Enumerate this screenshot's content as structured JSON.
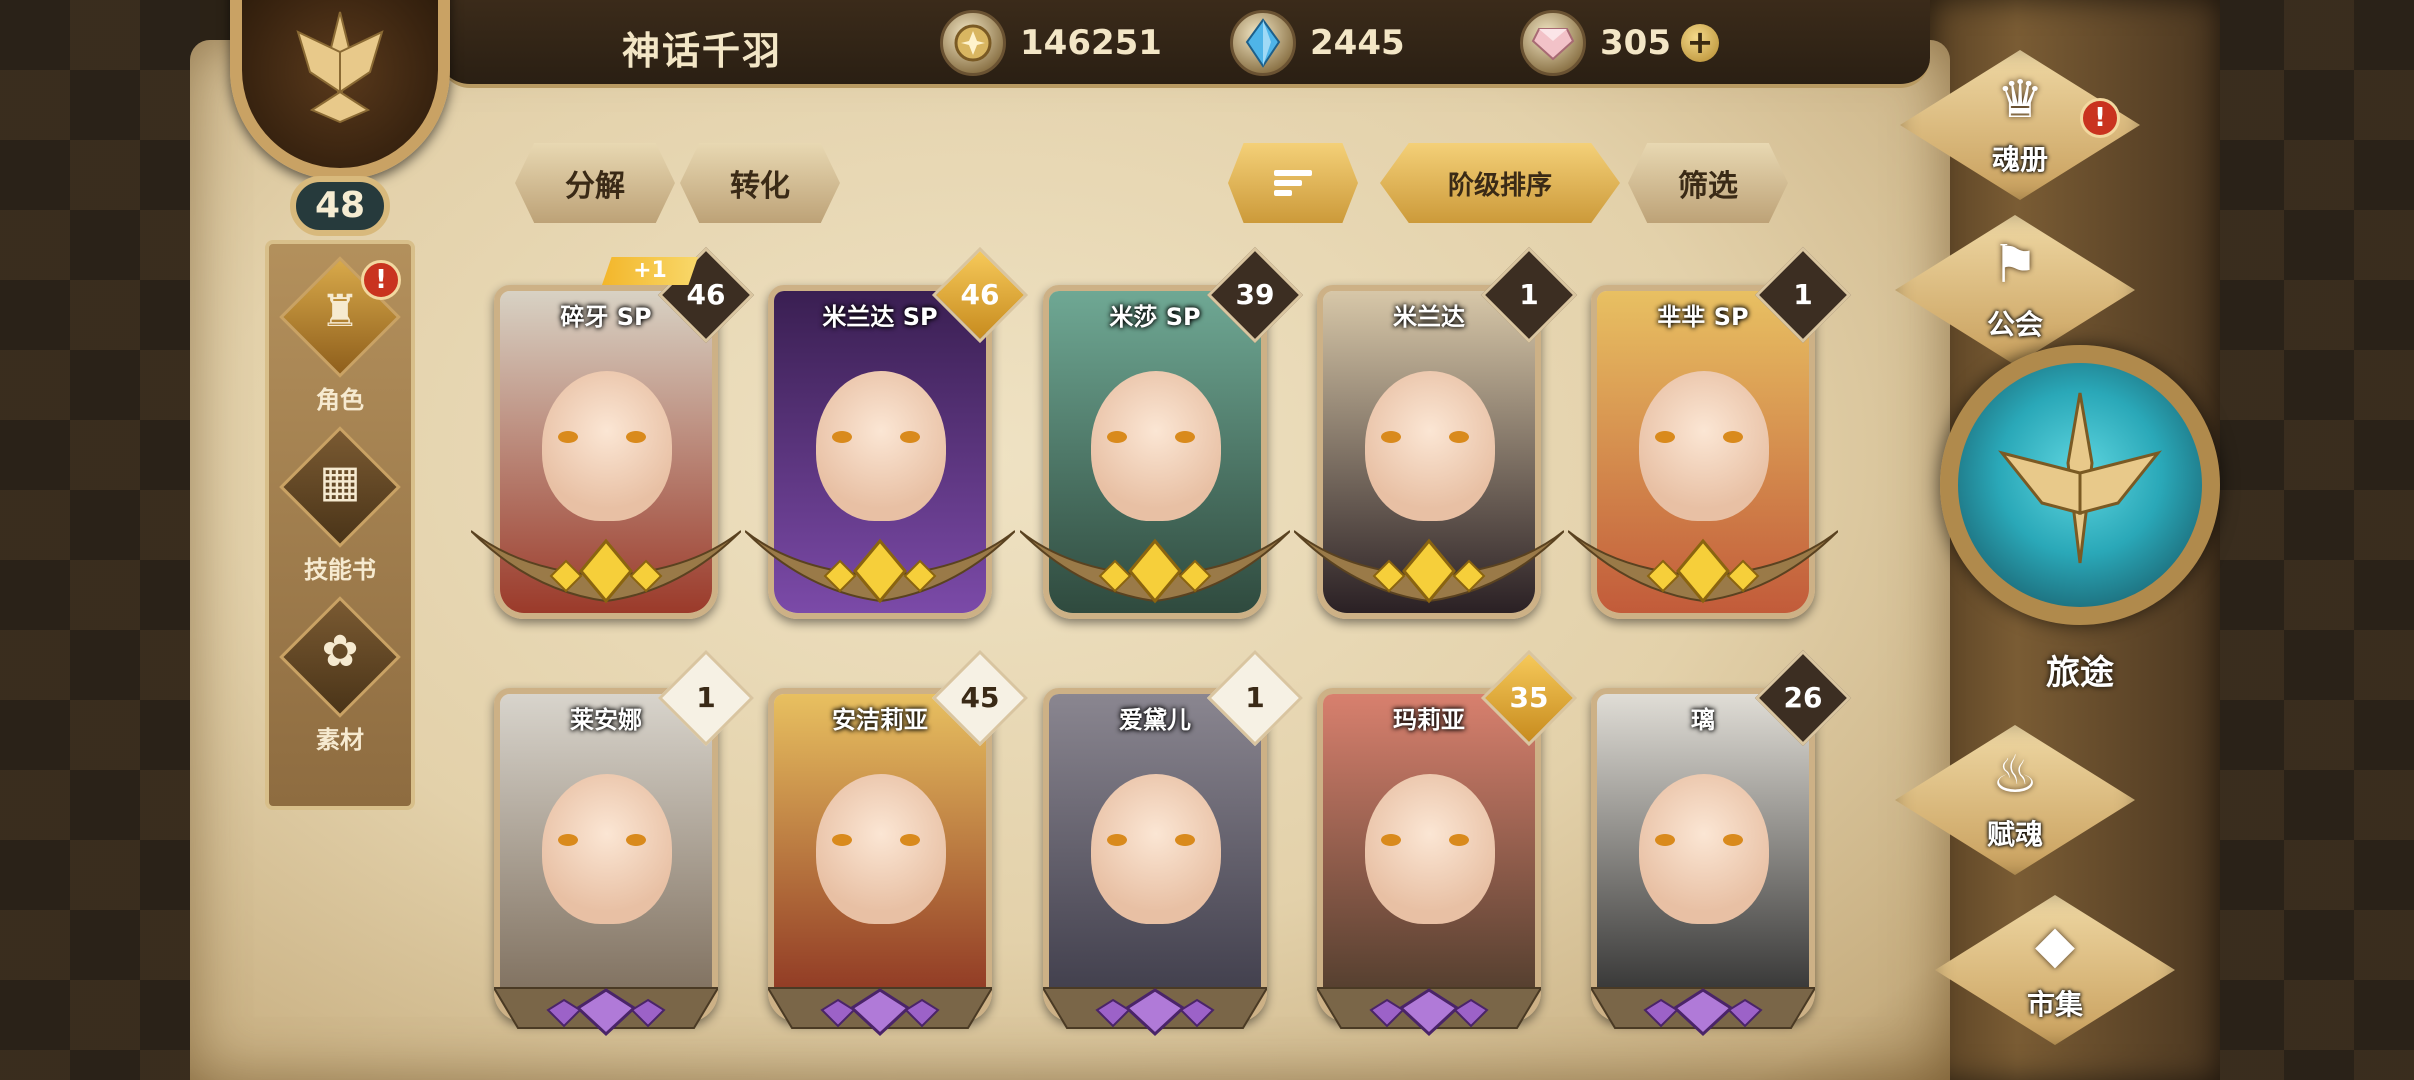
{
  "player": {
    "name": "神话千羽",
    "level": "48"
  },
  "currencies": {
    "gold": {
      "icon": "gold-coin-icon",
      "value": "146251"
    },
    "crystal": {
      "icon": "blue-crystal-icon",
      "value": "2445"
    },
    "gem": {
      "icon": "pink-gem-icon",
      "value": "305"
    }
  },
  "left_nav": {
    "items": [
      {
        "label": "角色",
        "icon": "character-icon",
        "active": true,
        "alert": "!"
      },
      {
        "label": "技能书",
        "icon": "skill-book-icon",
        "active": false
      },
      {
        "label": "素材",
        "icon": "material-icon",
        "active": false
      }
    ]
  },
  "toolbar": {
    "decompose": "分解",
    "convert": "转化",
    "sort_icon": "sort-icon",
    "sort_by_rank": "阶级排序",
    "filter": "筛选"
  },
  "heroes": [
    {
      "name": "碎牙 SP",
      "level": "46",
      "tag": "dark",
      "bonus": "+1",
      "base": "gold",
      "palette": [
        "#d8d2c4",
        "#9b3a2a"
      ]
    },
    {
      "name": "米兰达 SP",
      "level": "46",
      "tag": "gold",
      "base": "gold",
      "palette": [
        "#3a1f52",
        "#7b4aa8"
      ]
    },
    {
      "name": "米莎 SP",
      "level": "39",
      "tag": "dark",
      "base": "gold",
      "palette": [
        "#6fa894",
        "#2f4a3e"
      ]
    },
    {
      "name": "米兰达",
      "level": "1",
      "tag": "dark",
      "base": "gold",
      "palette": [
        "#d7c7a8",
        "#2a2024"
      ]
    },
    {
      "name": "芈芈 SP",
      "level": "1",
      "tag": "dark",
      "base": "gold",
      "palette": [
        "#e8c062",
        "#c25b3a"
      ]
    },
    {
      "name": "莱安娜",
      "level": "1",
      "tag": "light",
      "base": "purple",
      "palette": [
        "#d8d4cc",
        "#7a6a58"
      ]
    },
    {
      "name": "安洁莉亚",
      "level": "45",
      "tag": "light",
      "base": "purple",
      "palette": [
        "#e8c060",
        "#8a3020"
      ]
    },
    {
      "name": "爱黛儿",
      "level": "1",
      "tag": "light",
      "base": "purple",
      "palette": [
        "#8a8690",
        "#3c3a48"
      ]
    },
    {
      "name": "玛莉亚",
      "level": "35",
      "tag": "gold",
      "base": "purple",
      "palette": [
        "#d8806e",
        "#4a3a2a"
      ]
    },
    {
      "name": "璃",
      "level": "26",
      "tag": "dark",
      "base": "purple",
      "palette": [
        "#e0ddd6",
        "#2a2a2a"
      ]
    }
  ],
  "right_menu": {
    "soul_book": {
      "label": "魂册",
      "icon": "soul-book-icon",
      "alert": "!"
    },
    "guild": {
      "label": "公会",
      "icon": "guild-banner-icon"
    },
    "journey": {
      "label": "旅途",
      "icon": "compass-emblem-icon"
    },
    "endow": {
      "label": "赋魂",
      "icon": "flame-swirl-icon"
    },
    "market": {
      "label": "市集",
      "icon": "gem-shop-icon"
    }
  },
  "colors": {
    "parchment": "#e8d7b0",
    "gold_accent": "#f4d078",
    "alert_red": "#c9331f",
    "journey_teal": "#2aa8b8"
  }
}
